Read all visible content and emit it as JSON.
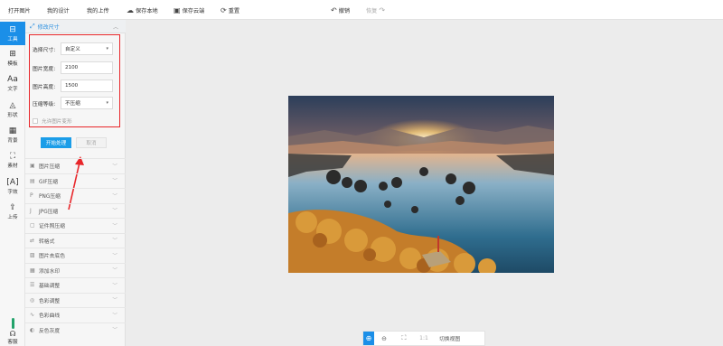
{
  "toolbar": {
    "open": "打开图片",
    "my_designs": "我的设计",
    "my_uploads": "我的上传",
    "save_local": "保存本地",
    "save_cloud": "保存云端",
    "reset": "重置",
    "undo": "撤销",
    "redo": "恢复"
  },
  "rail": {
    "items": [
      {
        "label": "工具",
        "icon": "toolbox-icon"
      },
      {
        "label": "模板",
        "icon": "template-icon"
      },
      {
        "label": "文字",
        "icon": "text-icon"
      },
      {
        "label": "形状",
        "icon": "shape-icon"
      },
      {
        "label": "背景",
        "icon": "background-icon"
      },
      {
        "label": "素材",
        "icon": "material-icon"
      },
      {
        "label": "字效",
        "icon": "text-effect-icon"
      },
      {
        "label": "上传",
        "icon": "upload-icon"
      }
    ],
    "service": "客服"
  },
  "panel": {
    "section_title": "修改尺寸",
    "select_size_label": "选择尺寸:",
    "select_size_value": "自定义",
    "width_label": "图片宽度:",
    "width_value": "2100",
    "height_label": "图片高度:",
    "height_value": "1500",
    "compress_label": "压缩等级:",
    "compress_value": "不压缩",
    "allow_deform": "允许图片变形",
    "start_button": "开始处理",
    "cancel_button": "取消",
    "menu": [
      "图片压缩",
      "GIF压缩",
      "PNG压缩",
      "JPG压缩",
      "证件照压缩",
      "转格式",
      "图片去底色",
      "添加水印",
      "基础调整",
      "色彩调整",
      "色彩曲线",
      "反色灰度"
    ]
  },
  "zoom": {
    "fit_label": "1:1",
    "switch_view": "切换视图"
  },
  "colors": {
    "accent": "#1b8fe8",
    "highlight_box": "#e8262a"
  }
}
